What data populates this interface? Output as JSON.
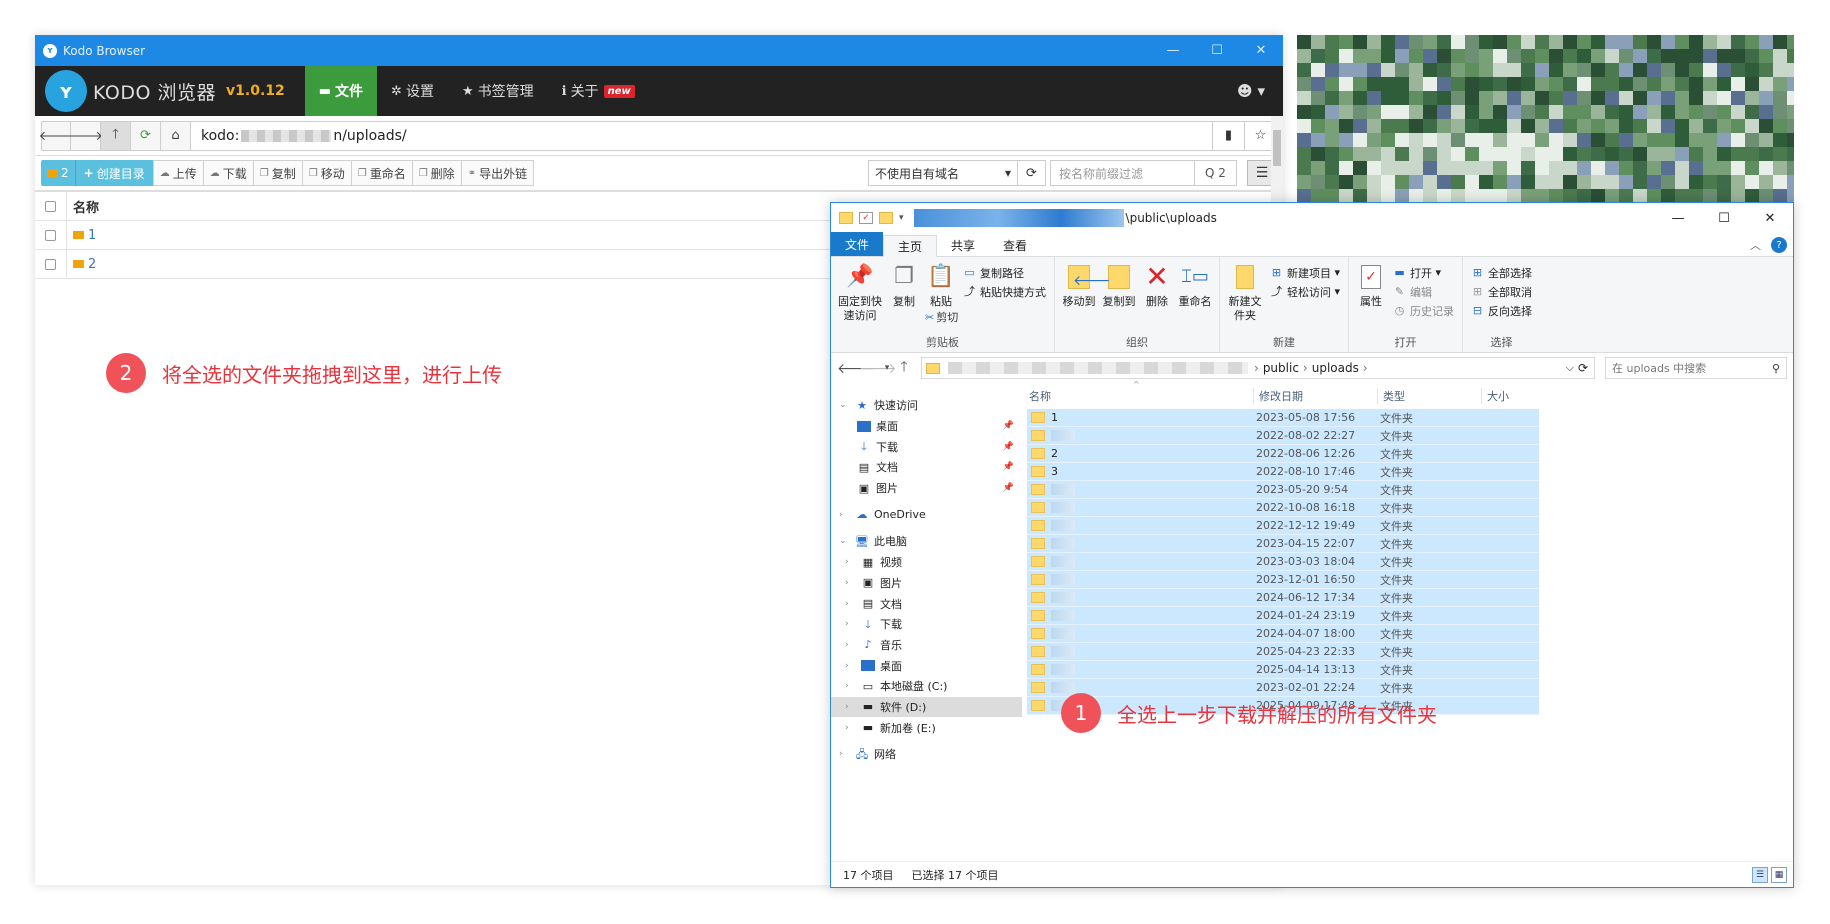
{
  "kodo": {
    "window_title": "Kodo Browser",
    "app_name": "KODO 浏览器",
    "version": "v1.0.12",
    "nav": [
      {
        "label": "文件",
        "icon": "folder-icon",
        "active": true
      },
      {
        "label": "设置",
        "icon": "gear-icon"
      },
      {
        "label": "书签管理",
        "icon": "star-icon"
      },
      {
        "label": "关于",
        "icon": "info-icon",
        "badge": "new"
      }
    ],
    "address": {
      "prefix": "kodo:",
      "suffix": "n/uploads/"
    },
    "toolbar": {
      "selected_count": "2",
      "create_dir": "创建目录",
      "upload": "上传",
      "download": "下载",
      "copy": "复制",
      "move": "移动",
      "rename": "重命名",
      "delete": "删除",
      "export_links": "导出外链",
      "domain_select": "不使用自有域名",
      "filter_placeholder": "按名称前缀过滤",
      "search_count": "Q 2"
    },
    "table": {
      "header_name": "名称",
      "rows": [
        {
          "name": "1"
        },
        {
          "name": "2"
        }
      ]
    }
  },
  "annotations": {
    "step2": {
      "num": "2",
      "text": "将全选的文件夹拖拽到这里，进行上传"
    },
    "step1": {
      "num": "1",
      "text": "全选上一步下载并解压的所有文件夹"
    }
  },
  "explorer": {
    "title_path": "\\public\\uploads",
    "ribbon_tabs": [
      "文件",
      "主页",
      "共享",
      "查看"
    ],
    "ribbon": {
      "clipboard": {
        "label": "剪贴板",
        "pin": "固定到快速访问",
        "copy": "复制",
        "paste": "粘贴",
        "copy_path": "复制路径",
        "paste_shortcut": "粘贴快捷方式",
        "cut": "剪切"
      },
      "organize": {
        "label": "组织",
        "move_to": "移动到",
        "copy_to": "复制到",
        "delete": "删除",
        "rename": "重命名"
      },
      "new": {
        "label": "新建",
        "new_folder": "新建文件夹",
        "new_item": "新建项目",
        "easy_access": "轻松访问"
      },
      "open": {
        "label": "打开",
        "properties": "属性",
        "open": "打开",
        "edit": "编辑",
        "history": "历史记录"
      },
      "select": {
        "label": "选择",
        "select_all": "全部选择",
        "select_none": "全部取消",
        "invert": "反向选择"
      }
    },
    "address": {
      "crumbs": [
        "public",
        "uploads"
      ],
      "search_placeholder": "在 uploads 中搜索"
    },
    "nav_pane": {
      "quick_access": "快速访问",
      "quick_items": [
        "桌面",
        "下载",
        "文档",
        "图片"
      ],
      "onedrive": "OneDrive",
      "this_pc": "此电脑",
      "pc_items": [
        "视频",
        "图片",
        "文档",
        "下载",
        "音乐",
        "桌面",
        "本地磁盘 (C:)",
        "软件 (D:)",
        "新加卷 (E:)"
      ],
      "network": "网络"
    },
    "columns": {
      "name": "名称",
      "modified": "修改日期",
      "type": "类型",
      "size": "大小"
    },
    "files": [
      {
        "name": "1",
        "date": "2023-05-08 17:56",
        "type": "文件夹"
      },
      {
        "name": "",
        "date": "2022-08-02 22:27",
        "type": "文件夹"
      },
      {
        "name": "2",
        "date": "2022-08-06 12:26",
        "type": "文件夹"
      },
      {
        "name": "3",
        "date": "2022-08-10 17:46",
        "type": "文件夹"
      },
      {
        "name": "",
        "date": "2023-05-20 9:54",
        "type": "文件夹"
      },
      {
        "name": "",
        "date": "2022-10-08 16:18",
        "type": "文件夹"
      },
      {
        "name": "",
        "date": "2022-12-12 19:49",
        "type": "文件夹"
      },
      {
        "name": "",
        "date": "2023-04-15 22:07",
        "type": "文件夹"
      },
      {
        "name": "",
        "date": "2023-03-03 18:04",
        "type": "文件夹"
      },
      {
        "name": "",
        "date": "2023-12-01 16:50",
        "type": "文件夹"
      },
      {
        "name": "",
        "date": "2024-06-12 17:34",
        "type": "文件夹"
      },
      {
        "name": "",
        "date": "2024-01-24 23:19",
        "type": "文件夹"
      },
      {
        "name": "",
        "date": "2024-04-07 18:00",
        "type": "文件夹"
      },
      {
        "name": "",
        "date": "2025-04-23 22:33",
        "type": "文件夹"
      },
      {
        "name": "",
        "date": "2025-04-14 13:13",
        "type": "文件夹"
      },
      {
        "name": "",
        "date": "2023-02-01 22:24",
        "type": "文件夹"
      },
      {
        "name": "",
        "date": "2025-04-09 17:48",
        "type": "文件夹"
      }
    ],
    "status": {
      "count": "17 个项目",
      "selected": "已选择 17 个项目"
    }
  }
}
